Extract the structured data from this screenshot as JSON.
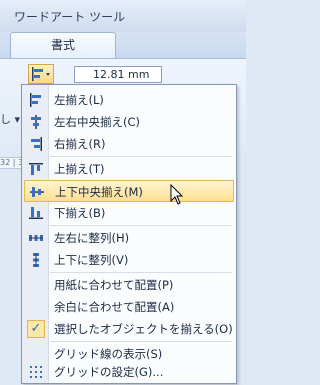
{
  "ribbon": {
    "context_title": "ワードアート ツール",
    "active_tab": "書式",
    "size_value": "12.81 mm",
    "ruler_text": "32 | 30",
    "left_snippet": "し ▾"
  },
  "menu": {
    "items": [
      {
        "label": "左揃え(L)",
        "icon": "align-left-icon"
      },
      {
        "label": "左右中央揃え(C)",
        "icon": "align-center-icon"
      },
      {
        "label": "右揃え(R)",
        "icon": "align-right-icon"
      },
      {
        "label": "上揃え(T)",
        "icon": "align-top-icon"
      },
      {
        "label": "上下中央揃え(M)",
        "icon": "align-middle-icon"
      },
      {
        "label": "下揃え(B)",
        "icon": "align-bottom-icon"
      },
      {
        "label": "左右に整列(H)",
        "icon": "distribute-horizontal-icon"
      },
      {
        "label": "上下に整列(V)",
        "icon": "distribute-vertical-icon"
      },
      {
        "label": "用紙に合わせて配置(P)",
        "icon": ""
      },
      {
        "label": "余白に合わせて配置(A)",
        "icon": ""
      },
      {
        "label": "選択したオブジェクトを揃える(O)",
        "icon": "checkmark-icon"
      },
      {
        "label": "グリッド線の表示(S)",
        "icon": ""
      },
      {
        "label": "グリッドの設定(G)...",
        "icon": "grid-icon"
      }
    ],
    "hovered_index": 4
  },
  "colors": {
    "hover_bg": "#ffdf92",
    "accent": "#2b6ac7"
  }
}
